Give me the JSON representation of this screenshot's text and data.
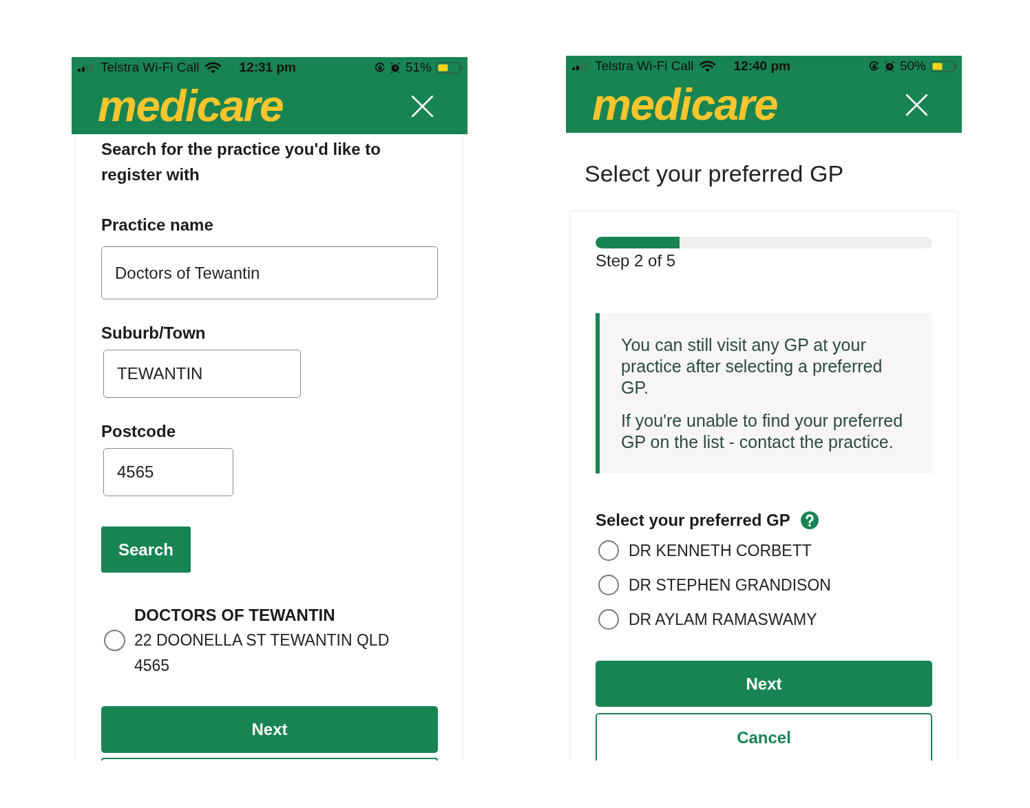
{
  "screens": [
    {
      "kind": "practice_search",
      "status_bar": {
        "carrier": "Telstra Wi-Fi Call",
        "time": "12:31 pm",
        "battery": "51%"
      },
      "header": {
        "logo": "medicare"
      },
      "heading": "Search for the practice you'd like to register with",
      "fields": [
        {
          "label": "Practice name",
          "value": "Doctors of Tewantin"
        },
        {
          "label": "Suburb/Town",
          "value": "TEWANTIN"
        },
        {
          "label": "Postcode",
          "value": "4565"
        }
      ],
      "search_button": "Search",
      "results": [
        {
          "name": "DOCTORS OF TEWANTIN",
          "address": "22 DOONELLA ST TEWANTIN QLD 4565",
          "selected": false
        }
      ],
      "next_button": "Next"
    },
    {
      "kind": "gp_select",
      "status_bar": {
        "carrier": "Telstra Wi-Fi Call",
        "time": "12:40 pm",
        "battery": "50%"
      },
      "header": {
        "logo": "medicare"
      },
      "title": "Select your preferred GP",
      "progress": {
        "level": 0.25,
        "label": "Step 2 of 5"
      },
      "notice": [
        "You can still visit any GP at your practice after selecting a preferred GP.",
        "If you're unable to find your preferred GP on the list - contact the practice."
      ],
      "gp_question": {
        "label": "Select your preferred GP",
        "options": [
          {
            "name": "DR KENNETH CORBETT",
            "selected": false
          },
          {
            "name": "DR STEPHEN GRANDISON",
            "selected": false
          },
          {
            "name": "DR AYLAM RAMASWAMY",
            "selected": false
          }
        ]
      },
      "next_button": "Next",
      "cancel_button": "Cancel"
    }
  ]
}
